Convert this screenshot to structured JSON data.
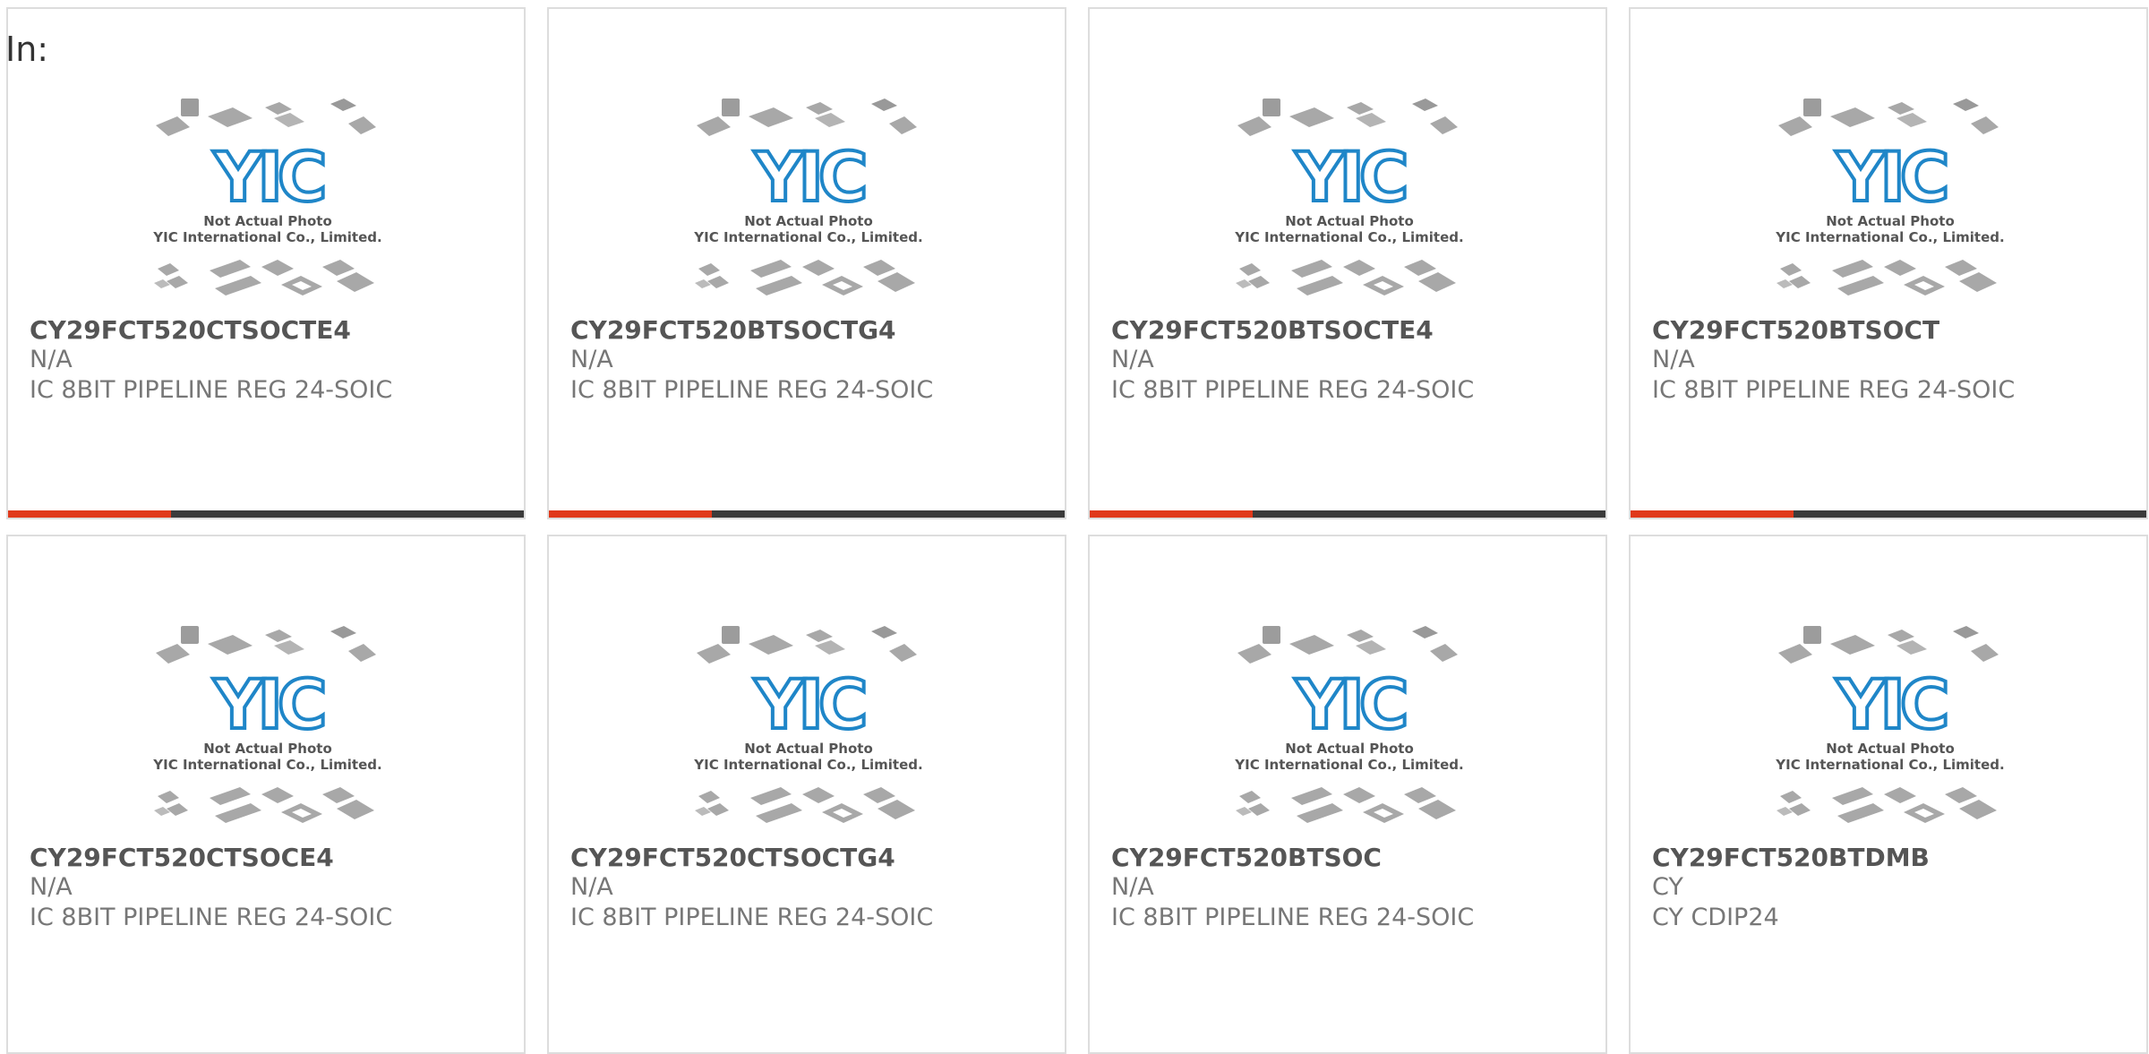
{
  "header": {
    "in_label": "In:"
  },
  "placeholder": {
    "logo_text": "YIC",
    "caption_line1": "Not Actual Photo",
    "caption_line2": "YIC International Co., Limited."
  },
  "colors": {
    "accent": "#e0391b",
    "bar_dark": "#3b3b3b",
    "logo_blue": "#1f86c8",
    "chip_gray": "#a8a8a8"
  },
  "products": [
    {
      "part_number": "CY29FCT520CTSOCTE4",
      "manufacturer": "N/A",
      "description": "IC 8BIT PIPELINE REG 24-SOIC"
    },
    {
      "part_number": "CY29FCT520BTSOCTG4",
      "manufacturer": "N/A",
      "description": "IC 8BIT PIPELINE REG 24-SOIC"
    },
    {
      "part_number": "CY29FCT520BTSOCTE4",
      "manufacturer": "N/A",
      "description": "IC 8BIT PIPELINE REG 24-SOIC"
    },
    {
      "part_number": "CY29FCT520BTSOCT",
      "manufacturer": "N/A",
      "description": "IC 8BIT PIPELINE REG 24-SOIC"
    },
    {
      "part_number": "CY29FCT520CTSOCE4",
      "manufacturer": "N/A",
      "description": "IC 8BIT PIPELINE REG 24-SOIC"
    },
    {
      "part_number": "CY29FCT520CTSOCTG4",
      "manufacturer": "N/A",
      "description": "IC 8BIT PIPELINE REG 24-SOIC"
    },
    {
      "part_number": "CY29FCT520BTSOC",
      "manufacturer": "N/A",
      "description": "IC 8BIT PIPELINE REG 24-SOIC"
    },
    {
      "part_number": "CY29FCT520BTDMB",
      "manufacturer": "CY",
      "description": "CY CDIP24"
    }
  ]
}
